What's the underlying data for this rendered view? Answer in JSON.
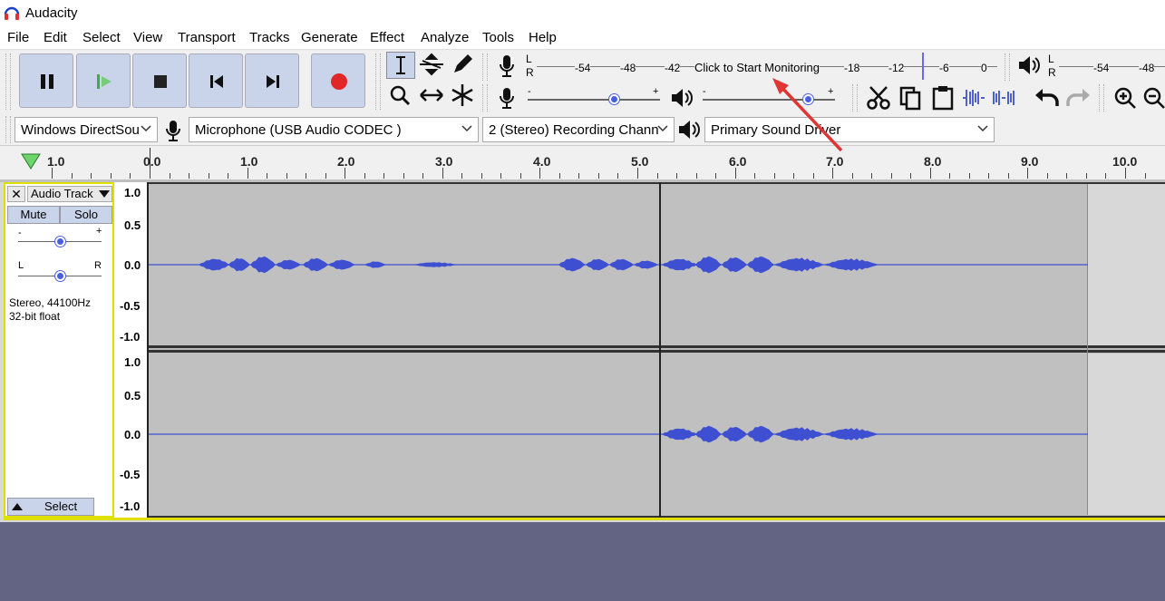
{
  "app": {
    "title": "Audacity"
  },
  "menu": [
    "File",
    "Edit",
    "Select",
    "View",
    "Transport",
    "Tracks",
    "Generate",
    "Effect",
    "Analyze",
    "Tools",
    "Help"
  ],
  "meter": {
    "record_ticks": [
      "-54",
      "-48",
      "-42",
      "-18",
      "-12",
      "-6",
      "0"
    ],
    "monitor_label": "Click to Start Monitoring",
    "play_ticks": [
      "-54",
      "-48"
    ],
    "L": "L",
    "R": "R"
  },
  "devices": {
    "host": "Windows DirectSou",
    "mic": "Microphone (USB Audio CODEC )",
    "channels": "2 (Stereo) Recording Chann",
    "output": "Primary Sound Driver"
  },
  "ruler": {
    "labels": [
      "1.0",
      "0.0",
      "1.0",
      "2.0",
      "3.0",
      "4.0",
      "5.0",
      "6.0",
      "7.0",
      "8.0",
      "9.0",
      "10.0"
    ]
  },
  "track": {
    "name": "Audio Track",
    "mute": "Mute",
    "solo": "Solo",
    "gain_plus": "+",
    "gain_minus": "-",
    "pan_l": "L",
    "pan_r": "R",
    "info1": "Stereo, 44100Hz",
    "info2": "32-bit float",
    "select": "Select"
  },
  "yaxis": [
    "1.0",
    "0.5",
    "0.0",
    "-0.5",
    "-1.0"
  ],
  "colors": {
    "wave": "#3e4fd1",
    "selection_bg": "#c0c0c0",
    "track_border": "#e0e000",
    "arrow": "#e03535"
  }
}
